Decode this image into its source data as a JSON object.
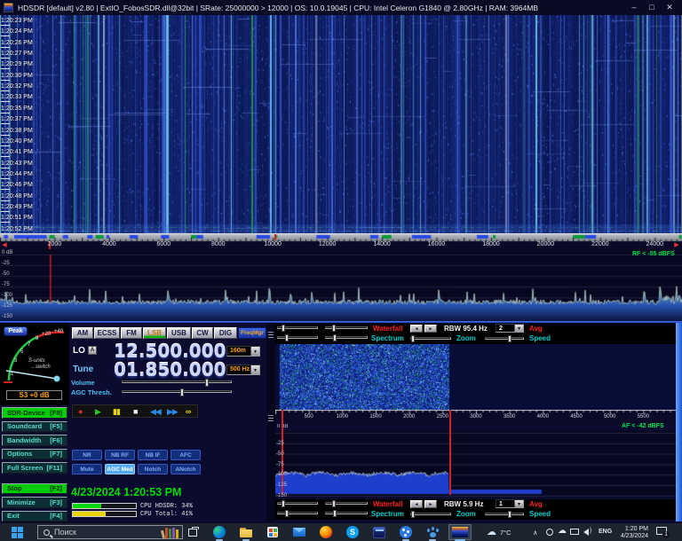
{
  "title_bar": {
    "title": "HDSDR [default]  v2.80  | ExtIO_FobosSDR.dll@32bit | SRate: 25000000 > 12000 | OS: 10.0.19045 | CPU: Intel Celeron G1840 @ 2.80GHz | RAM: 3964MB",
    "minimize": "–",
    "maximize": "□",
    "close": "✕"
  },
  "waterfall": {
    "timestamps": [
      "1:20:23 PM",
      "1:20:24 PM",
      "1:20:26 PM",
      "1:20:27 PM",
      "1:20:29 PM",
      "1:20:30 PM",
      "1:20:32 PM",
      "1:20:33 PM",
      "1:20:35 PM",
      "1:20:37 PM",
      "1:20:38 PM",
      "1:20:40 PM",
      "1:20:41 PM",
      "1:20:43 PM",
      "1:20:44 PM",
      "1:20:46 PM",
      "1:20:48 PM",
      "1:20:49 PM",
      "1:20:51 PM",
      "1:20:52 PM"
    ]
  },
  "rf_scale": {
    "tick_labels": [
      2000,
      4000,
      6000,
      8000,
      10000,
      12000,
      14000,
      16000,
      18000,
      20000,
      22000,
      24000
    ],
    "span_khz": 25000,
    "tune_marker_khz": 1850,
    "marker2_khz": 10100,
    "left_arrow": "◀",
    "right_arrow": "▶",
    "ham_bands_khz": [
      [
        1810,
        2000
      ],
      [
        3500,
        3800
      ],
      [
        7000,
        7200
      ],
      [
        10100,
        10150
      ],
      [
        14000,
        14350
      ],
      [
        18068,
        18168
      ],
      [
        21000,
        21450
      ],
      [
        24890,
        24990
      ]
    ],
    "broadcast_bands_khz": [
      [
        140,
        290
      ],
      [
        520,
        1710
      ],
      [
        2300,
        2500
      ],
      [
        3200,
        3400
      ],
      [
        3900,
        4000
      ],
      [
        4750,
        5060
      ],
      [
        5900,
        6200
      ],
      [
        7200,
        7450
      ],
      [
        9400,
        9900
      ],
      [
        11600,
        12100
      ],
      [
        13570,
        13870
      ],
      [
        15100,
        15800
      ],
      [
        17480,
        17900
      ],
      [
        21450,
        21850
      ]
    ]
  },
  "rf_spectrum": {
    "db_labels": [
      "0 dB",
      "-25",
      "-50",
      "-75",
      "-100",
      "-125",
      "-150"
    ],
    "overlay": "RF < -55 dBFS"
  },
  "smeter": {
    "peak": "Peak",
    "scale_labels": [
      "1",
      "3",
      "5",
      "7",
      "9",
      "+20",
      "+40"
    ],
    "hint_line1": "S-units",
    "hint_line2": "→switch",
    "readout": "S3 +0 dB"
  },
  "left_buttons": [
    {
      "name": "SDR-Device",
      "key": "[F8]",
      "style": "green"
    },
    {
      "name": "Soundcard",
      "key": "[F5]"
    },
    {
      "name": "Bandwidth",
      "key": "[F6]"
    },
    {
      "name": "Options",
      "key": "[F7]"
    },
    {
      "name": "Full Screen",
      "key": "[F11]"
    },
    {
      "name": "Stop",
      "key": "[F2]",
      "style": "green"
    },
    {
      "name": "Minimize",
      "key": "[F3]"
    },
    {
      "name": "Exit",
      "key": "[F4]"
    }
  ],
  "modes": {
    "items": [
      "AM",
      "ECSS",
      "FM",
      "LSB",
      "USB",
      "CW",
      "DIG"
    ],
    "active": "LSB",
    "freqmgr": "FreqMgr"
  },
  "lo": {
    "label": "LO",
    "lock": "A",
    "value": "12.500.000",
    "band": "160m"
  },
  "tune": {
    "label": "Tune",
    "value": "01.850.000",
    "step": "500 Hz"
  },
  "mixer": {
    "volume_label": "Volume",
    "agc_label": "AGC Thresh."
  },
  "playback": [
    {
      "name": "record",
      "glyph": "●",
      "color": "#d83030"
    },
    {
      "name": "play",
      "glyph": "▶",
      "color": "#28c828"
    },
    {
      "name": "pause",
      "glyph": "▮▮",
      "color": "#e8d400"
    },
    {
      "name": "stop",
      "glyph": "■",
      "color": "#f0f0f0"
    },
    {
      "name": "rewind",
      "glyph": "◀◀",
      "color": "#2a8ae8"
    },
    {
      "name": "fast-forward",
      "glyph": "▶▶",
      "color": "#2a8ae8"
    },
    {
      "name": "loop",
      "glyph": "∞",
      "color": "#e8d400"
    }
  ],
  "dsp": {
    "rows": [
      [
        "NR",
        "NB RF",
        "NB IF",
        "AFC"
      ],
      [
        "Mute",
        "AGC Med",
        "Notch",
        "ANotch"
      ]
    ],
    "active": "AGC Med"
  },
  "status": {
    "datetime": "4/23/2024 1:20:53 PM",
    "cpu": [
      {
        "label": "CPU HDSDR:",
        "value": "34%",
        "pct": 45,
        "color": "#00d800"
      },
      {
        "label": "CPU Total:",
        "value": "41%",
        "pct": 52,
        "color": "#e8d400"
      }
    ]
  },
  "af_top": {
    "waterfall": "Waterfall",
    "spectrum": "Spectrum",
    "rbw": "RBW 95.4 Hz",
    "avg_value": "2",
    "avg": "Avg",
    "zoom": "Zoom",
    "speed": "Speed",
    "arrow_left": "◄",
    "arrow_right": "►",
    "dd_arrow": "▾"
  },
  "af_bottom": {
    "waterfall": "Waterfall",
    "spectrum": "Spectrum",
    "rbw": "RBW  5.9 Hz",
    "avg_value": "1",
    "avg": "Avg",
    "zoom": "Zoom",
    "speed": "Speed",
    "arrow_left": "◄",
    "arrow_right": "►",
    "dd_arrow": "▾"
  },
  "af_scale": {
    "tick_labels": [
      500,
      1000,
      1500,
      2000,
      2500,
      3000,
      3500,
      4000,
      4500,
      5000,
      5500
    ],
    "span_hz": 6000,
    "filter_low_hz": 100,
    "filter_high_hz": 2600
  },
  "af_labels": {
    "zero": "0 dB",
    "rf_zero": "0 dB",
    "overlay": "AF < -42 dBFS"
  },
  "af_spectrum": {
    "db_labels": [
      "-25",
      "-50",
      "-75",
      "-100",
      "-125",
      "-150"
    ]
  },
  "taskbar": {
    "search_placeholder": "Поиск",
    "weather": "7°C",
    "chevron": "∧",
    "lang": "ENG",
    "time": "1:20 PM",
    "date": "4/23/2024",
    "badge": "1"
  }
}
